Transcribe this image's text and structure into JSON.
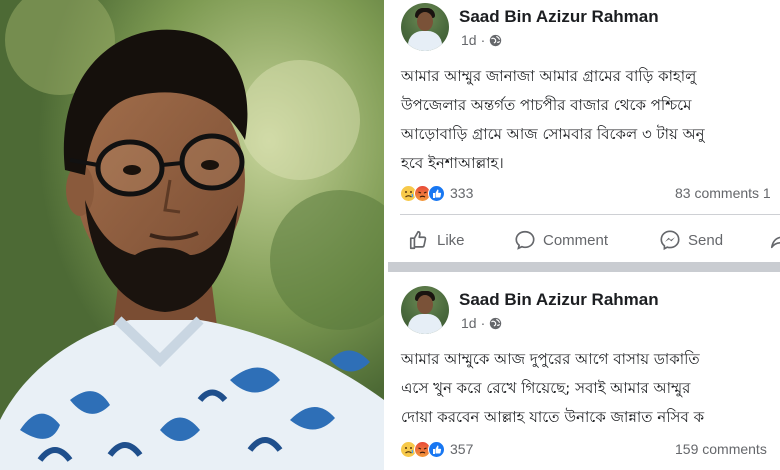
{
  "photo": {
    "alt_icon": "person-portrait"
  },
  "posts": [
    {
      "author": "Saad Bin Azizur Rahman",
      "time": "1d",
      "separator": "·",
      "privacy_icon": "globe-icon",
      "lines": [
        "আমার আম্মুর জানাজা আমার গ্রামের বাড়ি কাহালু",
        "উপজেলার অন্তর্গত পাচপীর বাজার থেকে পশ্চিমে",
        "আড়োবাড়ি গ্রামে আজ সোমবার বিকেল ৩ টায় অনু",
        "হবে ইনশাআল্লাহ।"
      ],
      "reaction_icons": [
        "sad-reaction-icon",
        "angry-reaction-icon",
        "like-reaction-icon"
      ],
      "reaction_count": "333",
      "comments": "83 comments  1",
      "actions": {
        "like": "Like",
        "comment": "Comment",
        "send": "Send"
      }
    },
    {
      "author": "Saad Bin Azizur Rahman",
      "time": "1d",
      "separator": "·",
      "privacy_icon": "globe-icon",
      "lines": [
        "আমার আম্মুকে আজ দুপুরের আগে বাসায় ডাকাতি",
        "এসে খুন করে রেখে গিয়েছে; সবাই আমার আম্মুর",
        "দোয়া করবেন আল্লাহ যাতে উনাকে জান্নাত নসিব ক"
      ],
      "reaction_icons": [
        "sad-reaction-icon",
        "angry-reaction-icon",
        "like-reaction-icon"
      ],
      "reaction_count": "357",
      "comments": "159 comments"
    }
  ],
  "colors": {
    "name": "#1c1e21",
    "secondary": "#65676b",
    "accent": "#1877f2",
    "separator": "#c9ccd1"
  }
}
